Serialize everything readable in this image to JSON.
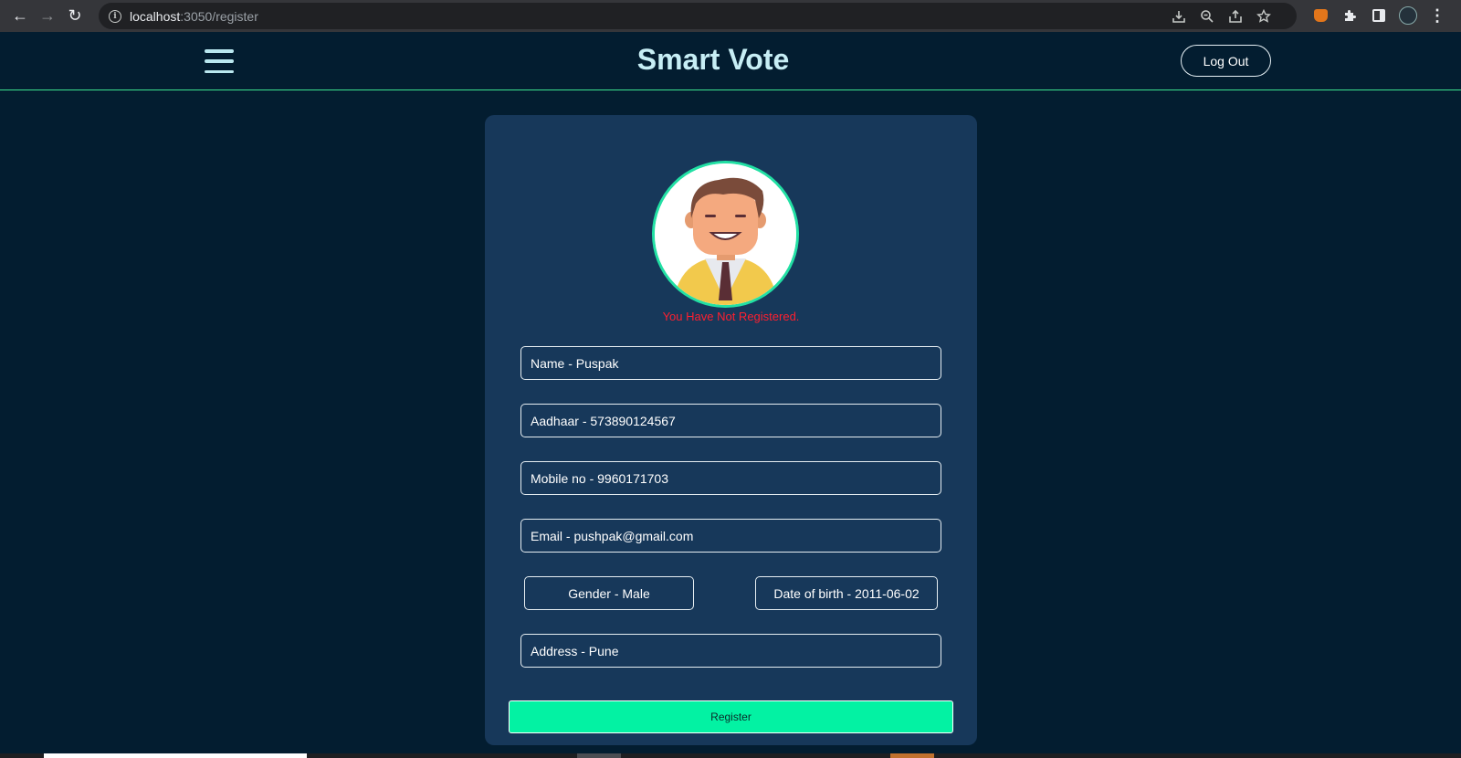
{
  "browser": {
    "url_host": "localhost",
    "url_rest": ":3050/register",
    "nav_back_glyph": "←",
    "nav_forward_glyph": "→",
    "reload_glyph": "↻",
    "icons": [
      "back-icon",
      "forward-icon",
      "reload-icon",
      "info-icon",
      "install-icon",
      "zoom-icon",
      "share-icon",
      "bookmark-star-icon",
      "metamask-fox-icon",
      "extensions-puzzle-icon",
      "side-panel-icon",
      "profile-avatar-icon",
      "more-menu-icon"
    ]
  },
  "header": {
    "title": "Smart Vote",
    "logout_label": "Log Out"
  },
  "form": {
    "status_message": "You Have Not Registered.",
    "name": "Name - Puspak",
    "aadhaar": "Aadhaar - 573890124567",
    "mobile": "Mobile no - 9960171703",
    "email": "Email - pushpak@gmail.com",
    "gender": "Gender - Male",
    "dob": "Date of birth - 2011-06-02",
    "address": "Address - Pune",
    "register_label": "Register"
  },
  "colors": {
    "page_bg": "#031d30",
    "card_bg": "#17385a",
    "accent_green": "#03f2a3",
    "status_red": "#ff1f2f",
    "title_color": "#c7eef5"
  }
}
